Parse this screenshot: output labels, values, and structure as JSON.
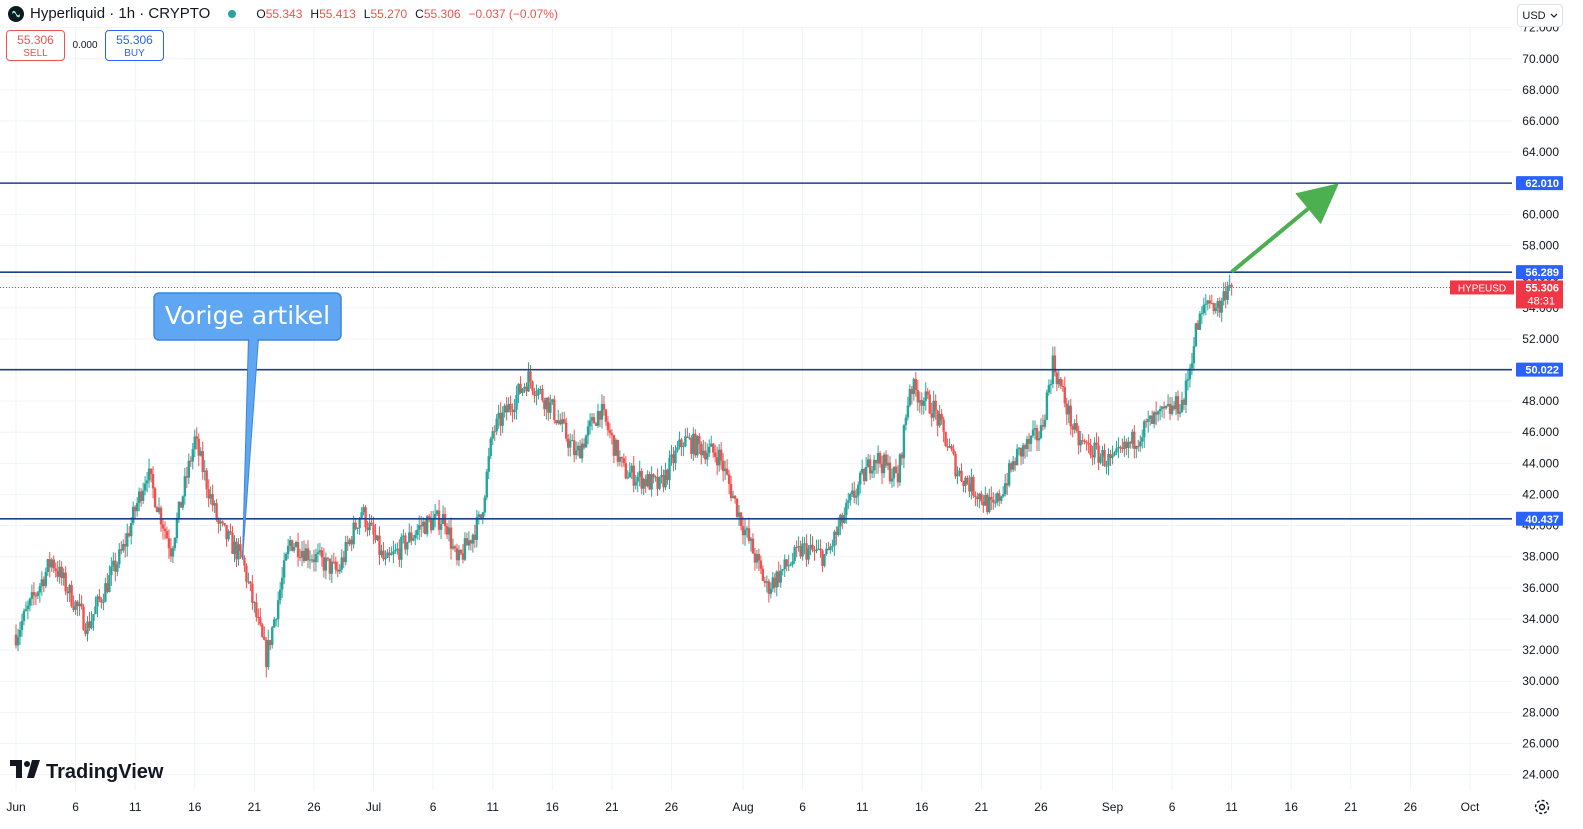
{
  "header": {
    "symbol_title": "Hyperliquid · 1h · CRYPTO",
    "ohlc": {
      "open_label": "O",
      "open": "55.343",
      "high_label": "H",
      "high": "55.413",
      "low_label": "L",
      "low": "55.270",
      "close_label": "C",
      "close": "55.306",
      "change": "−0.037 (−0.07%)"
    },
    "live_color": "#26a69a"
  },
  "trade_panel": {
    "sell_price": "55.306",
    "sell_label": "SELL",
    "spread": "0.000",
    "buy_price": "55.306",
    "buy_label": "BUY"
  },
  "currency_selector": {
    "value": "USD",
    "icon": "chevron-down-icon"
  },
  "brand": {
    "name": "TradingView",
    "icon": "tradingview-logo-icon"
  },
  "annotation": {
    "text": "Vorige artikel",
    "fill": "#5fa6f3"
  },
  "colors": {
    "up": "#26a69a",
    "down": "#ef5350",
    "level_line": "#1e3f8a",
    "arrow": "#4caf50",
    "price_tag": "#f23645",
    "level_tag": "#2962ff"
  },
  "chart_data": {
    "type": "candlestick",
    "symbol": "HYPEUSD",
    "timeframe": "1h",
    "x_ticks": [
      "Jun",
      "6",
      "11",
      "16",
      "21",
      "26",
      "Jul",
      "6",
      "11",
      "16",
      "21",
      "26",
      "Aug",
      "6",
      "11",
      "16",
      "21",
      "26",
      "Sep",
      "6",
      "11",
      "16",
      "21",
      "26",
      "Oct"
    ],
    "y_ticks": [
      "24.000",
      "26.000",
      "28.000",
      "30.000",
      "32.000",
      "34.000",
      "36.000",
      "38.000",
      "40.000",
      "42.000",
      "44.000",
      "46.000",
      "48.000",
      "50.000",
      "52.000",
      "54.000",
      "56.000",
      "58.000",
      "60.000",
      "62.000",
      "64.000",
      "66.000",
      "68.000",
      "70.000",
      "72.000"
    ],
    "ylim": [
      23.2,
      72.6
    ],
    "price_path": [
      [
        "2025-06-01",
        33.0
      ],
      [
        "2025-06-04",
        37.8
      ],
      [
        "2025-06-07",
        33.5
      ],
      [
        "2025-06-10",
        38.5
      ],
      [
        "2025-06-12",
        43.5
      ],
      [
        "2025-06-14",
        38.5
      ],
      [
        "2025-06-16",
        45.5
      ],
      [
        "2025-06-18",
        40.0
      ],
      [
        "2025-06-20",
        37.8
      ],
      [
        "2025-06-22",
        31.5
      ],
      [
        "2025-06-24",
        39.0
      ],
      [
        "2025-06-28",
        37.0
      ],
      [
        "2025-06-30",
        41.0
      ],
      [
        "2025-07-02",
        37.5
      ],
      [
        "2025-07-05",
        40.0
      ],
      [
        "2025-07-07",
        40.5
      ],
      [
        "2025-07-08",
        37.5
      ],
      [
        "2025-07-10",
        40.5
      ],
      [
        "2025-07-11",
        46.0
      ],
      [
        "2025-07-14",
        49.5
      ],
      [
        "2025-07-16",
        47.5
      ],
      [
        "2025-07-18",
        44.5
      ],
      [
        "2025-07-20",
        47.5
      ],
      [
        "2025-07-22",
        43.5
      ],
      [
        "2025-07-25",
        42.5
      ],
      [
        "2025-07-27",
        45.5
      ],
      [
        "2025-07-30",
        44.5
      ],
      [
        "2025-08-01",
        40.0
      ],
      [
        "2025-08-03",
        36.0
      ],
      [
        "2025-08-06",
        38.5
      ],
      [
        "2025-08-08",
        38.0
      ],
      [
        "2025-08-10",
        41.5
      ],
      [
        "2025-08-12",
        44.5
      ],
      [
        "2025-08-14",
        43.0
      ],
      [
        "2025-08-15",
        49.0
      ],
      [
        "2025-08-17",
        47.5
      ],
      [
        "2025-08-19",
        43.5
      ],
      [
        "2025-08-22",
        41.0
      ],
      [
        "2025-08-24",
        44.5
      ],
      [
        "2025-08-26",
        46.0
      ],
      [
        "2025-08-27",
        50.5
      ],
      [
        "2025-08-29",
        45.5
      ],
      [
        "2025-09-01",
        44.0
      ],
      [
        "2025-09-04",
        46.5
      ],
      [
        "2025-09-06",
        47.5
      ],
      [
        "2025-09-07",
        48.0
      ],
      [
        "2025-09-08",
        52.5
      ],
      [
        "2025-09-09",
        54.5
      ],
      [
        "2025-09-10",
        54.0
      ],
      [
        "2025-09-11",
        56.3
      ],
      [
        "2025-09-11",
        55.306
      ]
    ],
    "horizontal_levels": [
      "62.010",
      "56.289",
      "50.022",
      "40.437"
    ],
    "last_price": {
      "label": "HYPEUSD",
      "value": "55.306",
      "countdown": "48:31"
    },
    "arrow": {
      "from": [
        "2025-09-11",
        56.3
      ],
      "to": [
        "2025-09-20",
        62.0
      ],
      "direction": "up"
    },
    "annotation_point": [
      "2025-06-20",
      37.8
    ]
  }
}
